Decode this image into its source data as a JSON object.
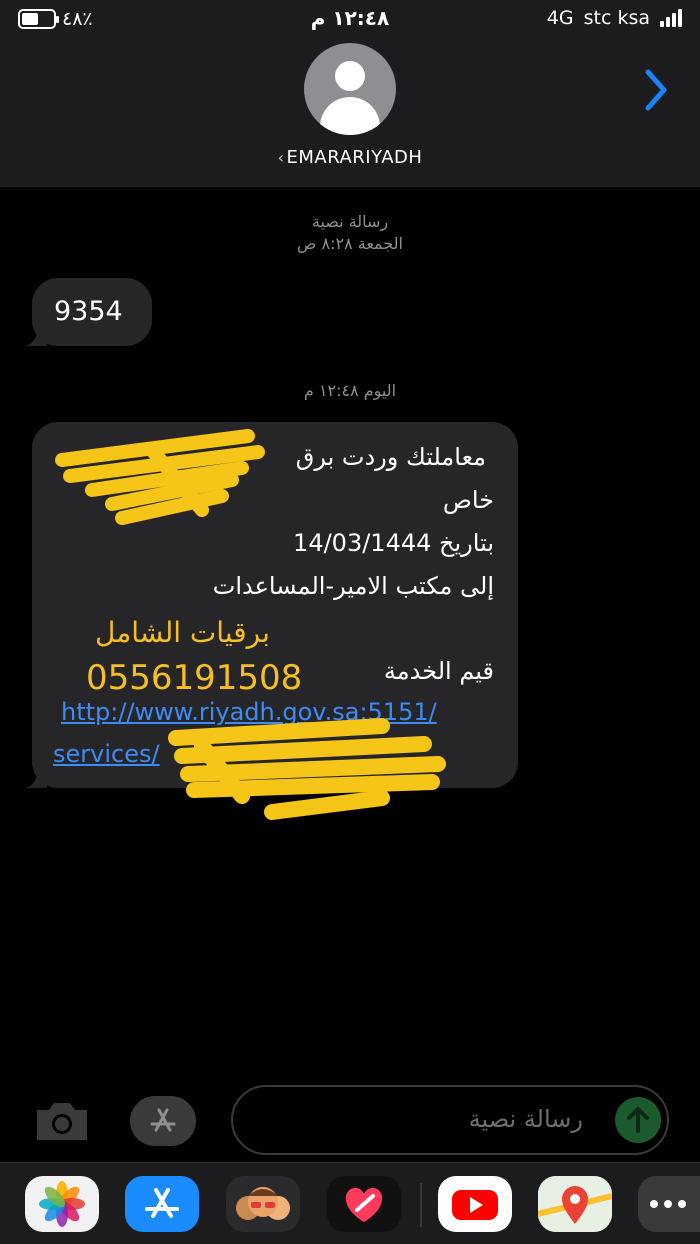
{
  "status_bar": {
    "battery_percent": "٤٨٪",
    "time": "١٢:٤٨ م",
    "network": "4G",
    "carrier": "stc ksa"
  },
  "header": {
    "contact_name": "EMARARIYADH",
    "back_icon": "chevron-right-icon",
    "accent_color": "#1a82fb"
  },
  "thread": {
    "meta_1": {
      "type": "رسالة نصية",
      "date": "الجمعة ٨:٢٨ ص"
    },
    "message_1": "9354",
    "meta_2": {
      "date": "اليوم ١٢:٤٨ م"
    },
    "message_2": {
      "line_1": "معاملتك وردت برق",
      "line_2": "خاص",
      "line_3": "بتاريخ 14/03/1444",
      "line_4": "إلى مكتب الامير-المساعدات",
      "line_5": "قيم الخدمة",
      "link_1": "http://www.riyadh.gov.sa:5151/",
      "link_2": "services/"
    },
    "overlay": {
      "name": "برقيات الشامل",
      "phone": "0556191508",
      "color": "#f7bf1f"
    }
  },
  "compose": {
    "placeholder": "رسالة نصية",
    "camera_icon": "camera-icon",
    "apps_icon": "app-store-icon",
    "send_icon": "send-arrow-icon"
  },
  "app_drawer": {
    "apps": [
      "photos-icon",
      "app-store-icon",
      "memoji-icon",
      "digital-touch-icon",
      "youtube-icon",
      "maps-icon",
      "more-icon"
    ]
  }
}
